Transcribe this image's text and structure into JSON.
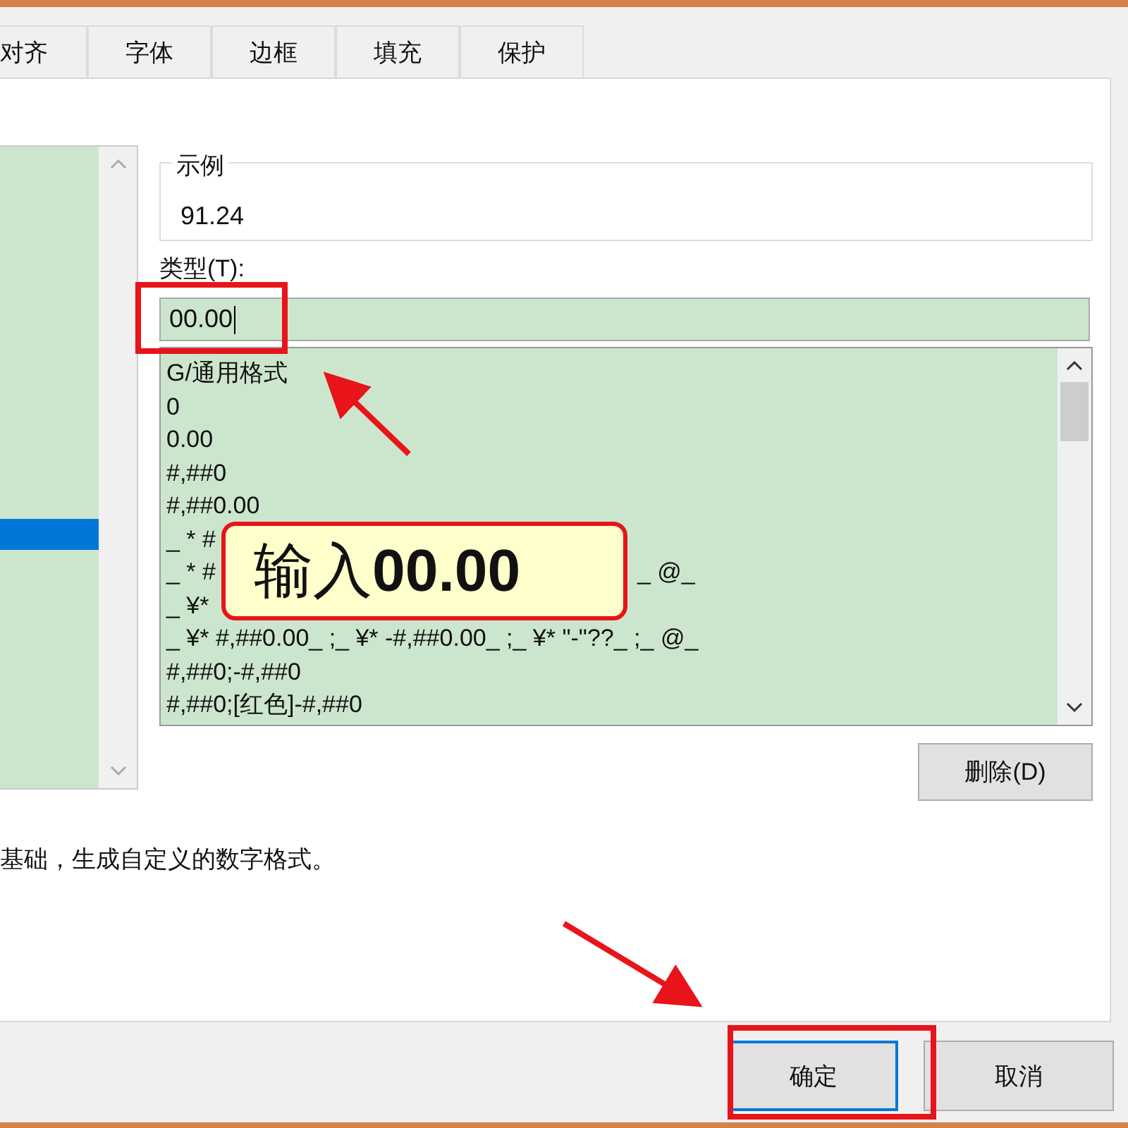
{
  "tabs": [
    {
      "label": "对齐",
      "selected": false
    },
    {
      "label": "字体",
      "selected": false
    },
    {
      "label": "边框",
      "selected": false
    },
    {
      "label": "填充",
      "selected": false
    },
    {
      "label": "保护",
      "selected": false
    }
  ],
  "category_list": {
    "rows": [
      {
        "selected": false
      },
      {
        "selected": false
      },
      {
        "selected": false
      },
      {
        "selected": false
      },
      {
        "selected": false
      },
      {
        "selected": false
      },
      {
        "selected": false
      },
      {
        "selected": false
      },
      {
        "selected": false
      },
      {
        "selected": false
      },
      {
        "selected": false
      },
      {
        "selected": false
      },
      {
        "selected": true
      }
    ]
  },
  "sample": {
    "legend": "示例",
    "value": "91.24"
  },
  "type_field": {
    "label": "类型(T):",
    "value": "00.00"
  },
  "type_list": [
    {
      "text": "G/通用格式"
    },
    {
      "text": "0"
    },
    {
      "text": "0.00"
    },
    {
      "text": "#,##0"
    },
    {
      "text": "#,##0.00"
    },
    {
      "text": "_ * #"
    },
    {
      "text": "_ * #",
      "tail": "_ @_"
    },
    {
      "text": "_ ¥*"
    },
    {
      "text": "_ ¥* #,##0.00_ ;_ ¥* -#,##0.00_ ;_ ¥* \"-\"??_ ;_ @_"
    },
    {
      "text": "#,##0;-#,##0"
    },
    {
      "text": "#,##0;[红色]-#,##0"
    }
  ],
  "delete_button": "删除(D)",
  "description": "基础，生成自定义的数字格式。",
  "buttons": [
    {
      "label": "确定",
      "kind": "default"
    },
    {
      "label": "取消",
      "kind": "normal"
    }
  ],
  "callout": "输入**00.00**"
}
